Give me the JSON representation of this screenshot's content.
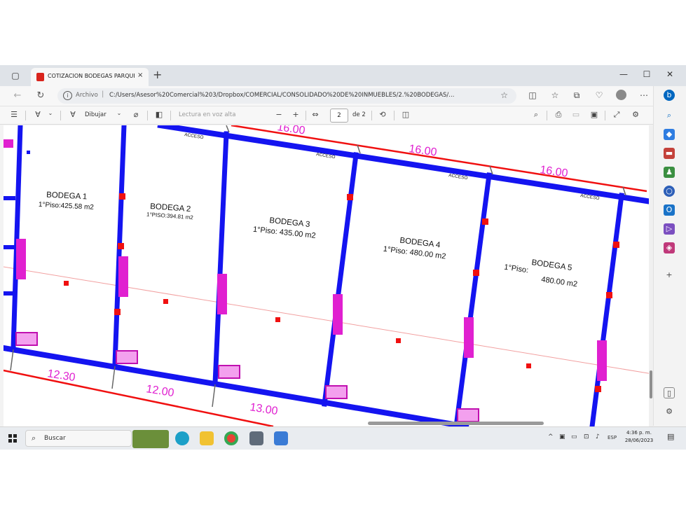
{
  "tab": {
    "title": "COTIZACION BODEGAS PARQUE",
    "close": "×",
    "new_tab": "+"
  },
  "window_controls": {
    "minimize": "—",
    "maximize": "☐",
    "close": "✕"
  },
  "address": {
    "scheme_label": "Archivo",
    "url": "C:/Users/Asesor%20Comercial%203/Dropbox/COMERCIAL/CONSOLIDADO%20DE%20INMUEBLES/2.%20BODEGAS/..."
  },
  "pdf_toolbar": {
    "draw_label": "Dibujar",
    "read_aloud_label": "Lectura en voz alta",
    "zoom_out": "−",
    "zoom_in": "+",
    "page_current": "2",
    "page_of": "de 2"
  },
  "plan": {
    "bodegas": [
      {
        "name": "BODEGA 1",
        "area": "1°Piso:425.58 m2"
      },
      {
        "name": "BODEGA 2",
        "area": "1°PISO:394.81 m2"
      },
      {
        "name": "BODEGA 3",
        "area": "1°Piso: 435.00 m2"
      },
      {
        "name": "BODEGA 4",
        "area": "1°Piso: 480.00 m2"
      },
      {
        "name": "BODEGA 5",
        "area": "1°Piso:",
        "area2": "480.00 m2"
      }
    ],
    "access_label": "ACCESO",
    "top_dims": [
      "16.00",
      "16.00",
      "16.00"
    ],
    "bottom_dims": [
      "12.30",
      "12.00",
      "13.00"
    ]
  },
  "taskbar": {
    "search_placeholder": "Buscar",
    "lang": "ESP",
    "time": "4:36 p. m.",
    "date": "28/06/2023"
  },
  "colors": {
    "wall": "#1414f0",
    "dimension_line": "#f01010",
    "marker": "#e020d0",
    "accent": "#0067c0"
  }
}
